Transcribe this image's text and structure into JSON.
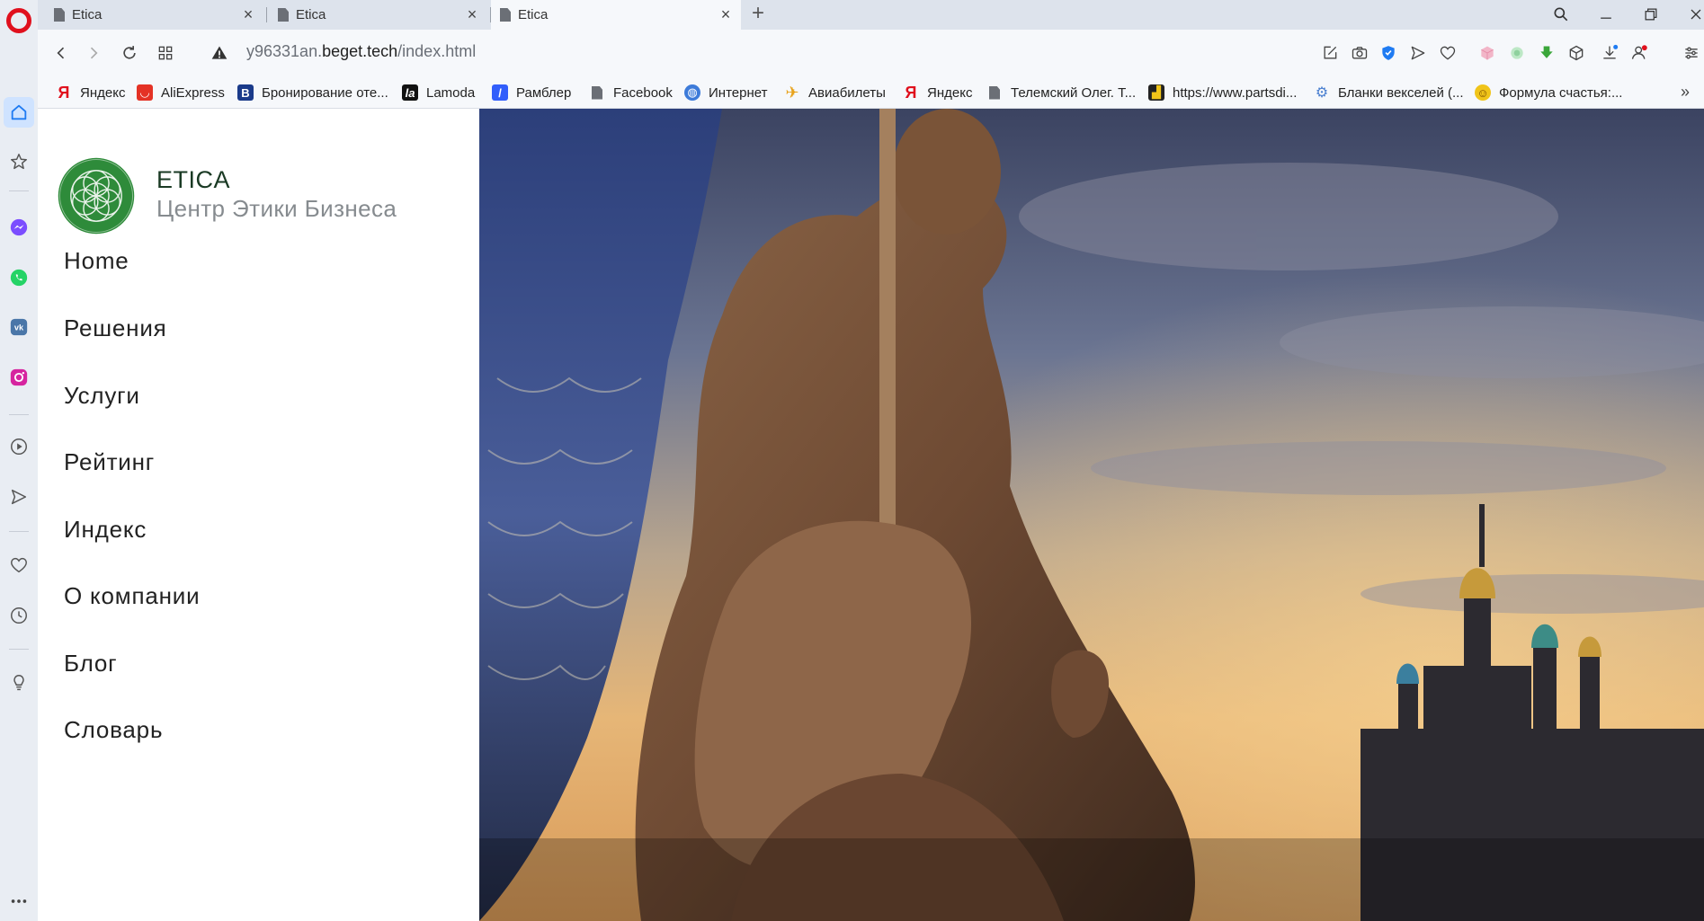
{
  "browser": {
    "tabs": [
      {
        "title": "Etica",
        "active": false
      },
      {
        "title": "Etica",
        "active": false
      },
      {
        "title": "Etica",
        "active": true
      }
    ],
    "new_tab_glyph": "+",
    "url": {
      "prefix": "y96331an.",
      "host": "beget.tech",
      "path": "/index.html"
    },
    "bookmarks": [
      {
        "label": "Яндекс",
        "icon": "yandex-icon",
        "color": "#e0101d"
      },
      {
        "label": "AliExpress",
        "icon": "aliexpress-icon",
        "color": "#e43225"
      },
      {
        "label": "Бронирование оте...",
        "icon": "booking-icon",
        "color": "#1a3a8a"
      },
      {
        "label": "Lamoda",
        "icon": "lamoda-icon",
        "color": "#111111"
      },
      {
        "label": "Рамблер",
        "icon": "rambler-icon",
        "color": "#315efb"
      },
      {
        "label": "Facebook",
        "icon": "page-icon",
        "color": "#6b6f76"
      },
      {
        "label": "Интернет",
        "icon": "globe-icon",
        "color": "#3d7bd9"
      },
      {
        "label": "Авиабилеты",
        "icon": "plane-icon",
        "color": "#e8a21a"
      },
      {
        "label": "Яндекс",
        "icon": "yandex-icon",
        "color": "#e0101d"
      },
      {
        "label": "Телемский Олег. Т...",
        "icon": "page-icon",
        "color": "#6b6f76"
      },
      {
        "label": "https://www.partsdi...",
        "icon": "partsdi-icon",
        "color": "#222222"
      },
      {
        "label": "Бланки векселей (...",
        "icon": "gear-icon",
        "color": "#4a7fd0"
      },
      {
        "label": "Формула счастья:...",
        "icon": "smiley-icon",
        "color": "#f0c419"
      }
    ],
    "bookmarks_more_glyph": "»"
  },
  "site": {
    "brand_name": "ETICA",
    "brand_tagline": "Центр Этики Бизнеса",
    "brand_color": "#2e8b3a",
    "menu": [
      "Home",
      "Решения",
      "Услуги",
      "Рейтинг",
      "Индекс",
      "О компании",
      "Блог",
      "Словарь"
    ],
    "hero_image": "angel-statues-over-st-petersburg-sunset"
  },
  "colors": {
    "opera_red": "#e0101d",
    "sidebar_bg": "#e9edf3",
    "tabstrip_bg": "#dde3ec",
    "toolbar_bg": "#f6f8fb"
  }
}
